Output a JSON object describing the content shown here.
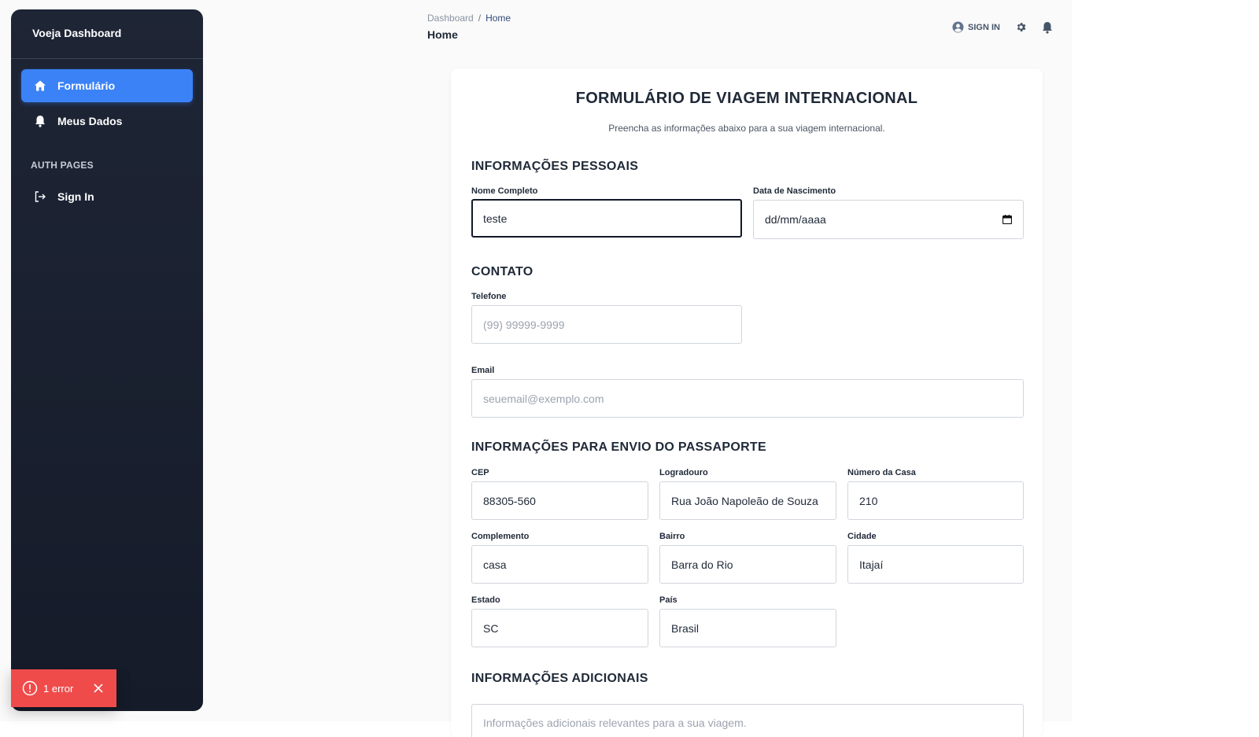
{
  "sidebar": {
    "brand": "Voeja Dashboard",
    "items": [
      {
        "label": "Formulário",
        "icon": "home-icon",
        "active": true
      },
      {
        "label": "Meus Dados",
        "icon": "bell-icon",
        "active": false
      }
    ],
    "section_label": "AUTH PAGES",
    "auth_items": [
      {
        "label": "Sign In",
        "icon": "sign-in-icon"
      }
    ]
  },
  "header": {
    "breadcrumb": [
      "Dashboard",
      "Home"
    ],
    "breadcrumb_separator": "/",
    "title": "Home",
    "signin_label": "SIGN IN"
  },
  "form": {
    "title": "FORMULÁRIO DE VIAGEM INTERNACIONAL",
    "subtitle": "Preencha as informações abaixo para a sua viagem internacional.",
    "sections": {
      "personal": "INFORMAÇÕES PESSOAIS",
      "contact": "CONTATO",
      "passport": "INFORMAÇÕES PARA ENVIO DO PASSAPORTE",
      "additional": "INFORMAÇÕES ADICIONAIS"
    },
    "fields": {
      "nome": {
        "label": "Nome Completo",
        "value": "teste",
        "placeholder": ""
      },
      "nascimento": {
        "label": "Data de Nascimento",
        "value": "dd/mm/aaaa"
      },
      "telefone": {
        "label": "Telefone",
        "value": "",
        "placeholder": "(99) 99999-9999"
      },
      "email": {
        "label": "Email",
        "value": "",
        "placeholder": "seuemail@exemplo.com"
      },
      "cep": {
        "label": "CEP",
        "value": "88305-560"
      },
      "logradouro": {
        "label": "Logradouro",
        "value": "Rua João Napoleão de Souza"
      },
      "numero": {
        "label": "Número da Casa",
        "value": "210"
      },
      "complemento": {
        "label": "Complemento",
        "value": "casa"
      },
      "bairro": {
        "label": "Bairro",
        "value": "Barra do Rio"
      },
      "cidade": {
        "label": "Cidade",
        "value": "Itajaí"
      },
      "estado": {
        "label": "Estado",
        "value": "SC"
      },
      "pais": {
        "label": "País",
        "value": "Brasil"
      },
      "adicionais": {
        "label": "",
        "value": "",
        "placeholder": "Informações adicionais relevantes para a sua viagem."
      }
    }
  },
  "toast": {
    "text": "1 error"
  },
  "colors": {
    "sidebar_bg": "#1a2030",
    "accent": "#3b82f6",
    "error": "#ef4b4b"
  }
}
